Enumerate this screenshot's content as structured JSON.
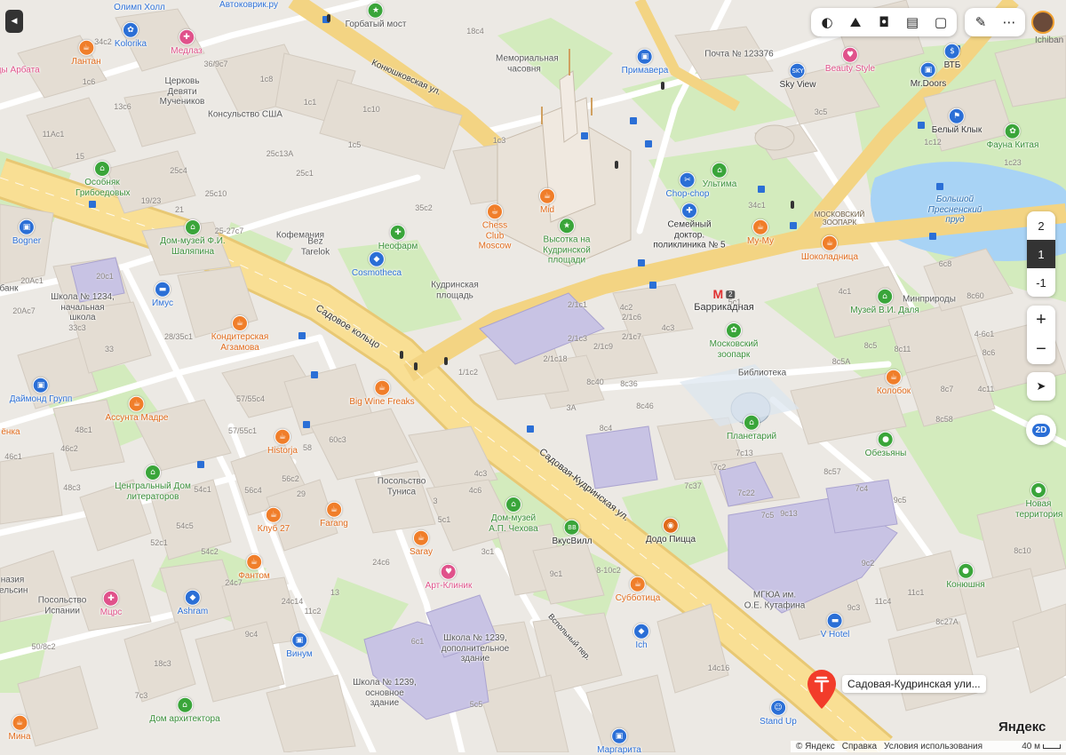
{
  "map": {
    "streets": [
      {
        "name": "Садовое кольцо"
      },
      {
        "name": "Садовая-Кудринская ул."
      },
      {
        "name": "Конюшковская ул."
      },
      {
        "name": "Вспольный пер."
      }
    ],
    "places": {
      "olimp": "Олимп Холл",
      "avtokovrik": "Автоковрик.ру",
      "gorbaty": "Горбатый мост",
      "kolorika": "Kolorika",
      "medlaz": "Медлаз",
      "lantan": "Лантан",
      "arbat": "зды Арбата",
      "church": "Церковь Девяти Мучеников",
      "consulate": "Консульство США",
      "memorial": "Мемориальная часовня",
      "primavera": "Примавера",
      "post": "Почта № 123376",
      "skyview": "Sky View",
      "beauty": "Beauty Style",
      "vtb": "ВТБ",
      "mrdoors": "Mr.Doors",
      "granby": "Особняк Грибоедовых",
      "bellyklyk": "Белый Клык",
      "fauna": "Фауна Китая",
      "pond": "Большой Пресненский пруд",
      "zoo_label": "МОСКОВСКИЙ ЗООПАРК",
      "chopchop": "Chop-chop",
      "ultima": "Ультима",
      "mid": "Mid",
      "chess": "Chess Club Moscow",
      "neofarm": "Неофарм",
      "kofemania": "Кофемания",
      "beztarelok": "Bez Tarelok",
      "cosmotheca": "Cosmotheca",
      "vysotka": "Высотка на Кудринской площади",
      "polyclinic": "Семейный доктор. поликлиника № 5",
      "mymu": "My-My",
      "shokolad": "Шоколадница",
      "bogner": "Bogner",
      "shalyapin": "Дом-музей Ф.И. Шаляпина",
      "bank": "банк",
      "school1234": "Школа № 1234, начальная школа",
      "imus": "Имус",
      "kudrinsk_sq": "Кудринская площадь",
      "barrikadnaya": "Баррикадная",
      "metro_line": "2",
      "minpriroda": "Минприроды",
      "dal": "Музей В.И. Даля",
      "zoo": "Московский зоопарк",
      "library": "Библиотека",
      "konditer": "Кондитерская Агзамова",
      "daimond": "Даймонд Групп",
      "kolobok": "Колобок",
      "bigwine": "Big Wine Freaks",
      "assunta": "Ассунта Мадре",
      "planetarium": "Планетарий",
      "enka": "ёнка",
      "historja": "Historja",
      "obezyany": "Обезьяны",
      "cdl": "Центральный Дом литераторов",
      "tunis": "Посольство Туниса",
      "chekhov": "Дом-музей А.П. Чехова",
      "vkusvill": "ВкусВилл",
      "dodo": "Додо Пицца",
      "novaya": "Новая территория",
      "club27": "Клуб 27",
      "farang": "Farang",
      "saray": "Saray",
      "fantom": "Фантом",
      "artklinik": "Арт-Клиник",
      "subbotitsa": "Субботица",
      "mgua": "МГЮА им. О.Е. Кутафина",
      "konyushnya": "Конюшня",
      "nazia": "назия ельсин",
      "spain": "Посольство Испании",
      "mts": "Мцрс",
      "ashram": "Ashram",
      "ich": "Ich",
      "vhotel": "V Hotel",
      "school1239a": "Школа № 1239, дополнительное здание",
      "vinum": "Винум",
      "school1239b": "Школа № 1239, основное здание",
      "architect": "Дом архитектора",
      "standup": "Stand Up",
      "margarita": "Маргарита",
      "mina": "Мина"
    },
    "house_numbers": [
      "34c2",
      "36/9c7",
      "1c8",
      "1c1",
      "1c10",
      "1c5",
      "25c13A",
      "25c1",
      "1c3",
      "18c4",
      "1c6",
      "13c6",
      "1c1",
      "11Ac1",
      "15",
      "19/23",
      "25c10",
      "21",
      "25c4",
      "25-27c7",
      "35c2",
      "20c1",
      "20Ac1",
      "20Ac7",
      "33c3",
      "33",
      "28/35c1",
      "57/55c1",
      "57/55c4",
      "46c2",
      "46c1",
      "48c1",
      "48c3",
      "52c1",
      "54c1",
      "54c2",
      "54c5",
      "56c4",
      "56c2",
      "60c3",
      "58",
      "29",
      "24c6",
      "24c7",
      "24c14",
      "11c2",
      "9c4",
      "6c1",
      "18c3",
      "50/8c2",
      "7c3",
      "13",
      "3",
      "5c1",
      "5c5",
      "4c3",
      "4c6",
      "3c1",
      "2/1c1",
      "2/1c3",
      "2/1c7",
      "2/1c6",
      "2/1c18",
      "1/1c2",
      "4c3",
      "2/1c9",
      "8c40",
      "8c36",
      "8c46",
      "3A",
      "8c4",
      "7c13",
      "7c2",
      "7c37",
      "7c22",
      "7c5",
      "9c13",
      "8c57",
      "7c4",
      "9c5",
      "9c2",
      "9c3",
      "8c10",
      "11c4",
      "8c27A",
      "11c1",
      "14c16",
      "8-10с2",
      "9c1",
      "4c1",
      "4c2",
      "3c5",
      "1c12",
      "5c1",
      "34c1",
      "8c5",
      "8c5A",
      "8c11",
      "8c7",
      "8c58",
      "6c8",
      "4-6c1",
      "8c60",
      "8c6",
      "1c23",
      "4c11"
    ],
    "selected_place": "Садовая-Кудринская ули...",
    "scale": "40 м",
    "copyright": "© Яндекс",
    "help": "Справка",
    "terms": "Условия использования",
    "logo": "Яндекс"
  },
  "toolbar": {
    "icons": [
      "layers-icon",
      "panorama-icon",
      "camera-icon",
      "transit-icon",
      "square-icon"
    ],
    "ruler": "ruler-icon",
    "more": "⋯",
    "user_name": "Ichiban B"
  },
  "floor": {
    "levels": [
      "2",
      "1",
      "-1"
    ],
    "selected": "1"
  },
  "zoom": {
    "plus": "+",
    "minus": "−"
  },
  "view_mode": "2D",
  "colors": {
    "road_major": "#f6d27a",
    "road_minor": "#ffffff",
    "park": "#cfe8b6",
    "water": "#a8d3f5",
    "building": "#e3ddd5",
    "building_highlight": "#c9c4e6",
    "pin_food": "#f07e2a",
    "pin_green": "#3aa53a",
    "pin_blue": "#2b6fd6",
    "pin_pink": "#e0528b",
    "pin_selected": "#f23c2a"
  }
}
